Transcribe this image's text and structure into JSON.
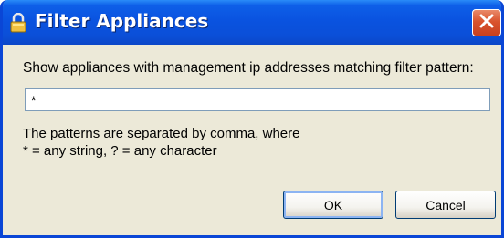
{
  "dialog": {
    "title": "Filter Appliances",
    "title_icon": "lock-icon",
    "close_icon": "close-icon",
    "prompt": "Show appliances with management ip addresses matching filter pattern:",
    "filter_value": "*",
    "help_line_1": "The patterns are separated by comma, where",
    "help_line_2": "* = any string, ? = any character",
    "ok_label": "OK",
    "cancel_label": "Cancel"
  },
  "colors": {
    "titlebar": "#0a53e0",
    "window_bg": "#ece9d8",
    "close_button": "#d9532d",
    "title_text": "#ffffff"
  }
}
